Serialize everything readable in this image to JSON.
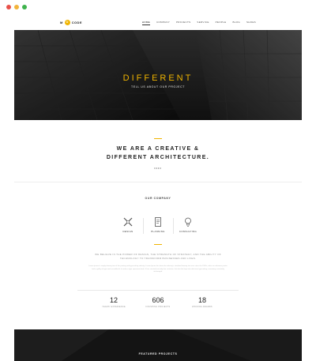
{
  "window": {
    "controls": [
      "close",
      "minimize",
      "maximize"
    ]
  },
  "brand": {
    "logo_left": "M",
    "logo_badge": "O",
    "logo_right": "CODE"
  },
  "nav": {
    "items": [
      "HOME",
      "COMPANY",
      "PROJECTS",
      "SERVICE",
      "PEOPLE",
      "BLOG",
      "SHOES"
    ],
    "active_index": 0
  },
  "hero": {
    "title": "DIFFERENT",
    "subtitle": "TELL US ABOUT OUR PROJECT"
  },
  "statement": {
    "line1": "WE ARE A CREATIVE &",
    "line2": "DIFFERENT ARCHITECTURE.",
    "dots": "••••"
  },
  "company": {
    "title": "OUR COMPANY",
    "features": [
      {
        "icon": "pencil-ruler-icon",
        "label": "DESIGN"
      },
      {
        "icon": "document-icon",
        "label": "PLANNING"
      },
      {
        "icon": "lightbulb-icon",
        "label": "CONSULTING"
      }
    ],
    "intro": "WE BELIEVE IN THE POWER OF DESIGN, THE STRENGTH OF STRATEGY, AND THE ABILITY OF TECHNOLOGY TO TRANSFORM BUSINESSES AND LIVES.",
    "body": "Lorem ipsum is simply dummy text of the printing and typesetting industry. Lorem Ipsum has been the industry's standard dummy text ever since the 1500s, when an unknown printer took a galley of type and scrambled it to make a type specimen book. It has survived not only five centuries, but also the leap into electronic typesetting, remaining essentially unchanged."
  },
  "stats": [
    {
      "value": "12",
      "label": "YEARS' EXPERIENCE"
    },
    {
      "value": "606",
      "label": "FINISHING PROJECTS"
    },
    {
      "value": "18",
      "label": "WINNING AWARDS"
    }
  ],
  "footer": {
    "title": "FEATURED PROJECTS"
  },
  "colors": {
    "accent": "#f0b400",
    "hero_bg": "#1c1c1c",
    "footer_bg": "#141414"
  }
}
